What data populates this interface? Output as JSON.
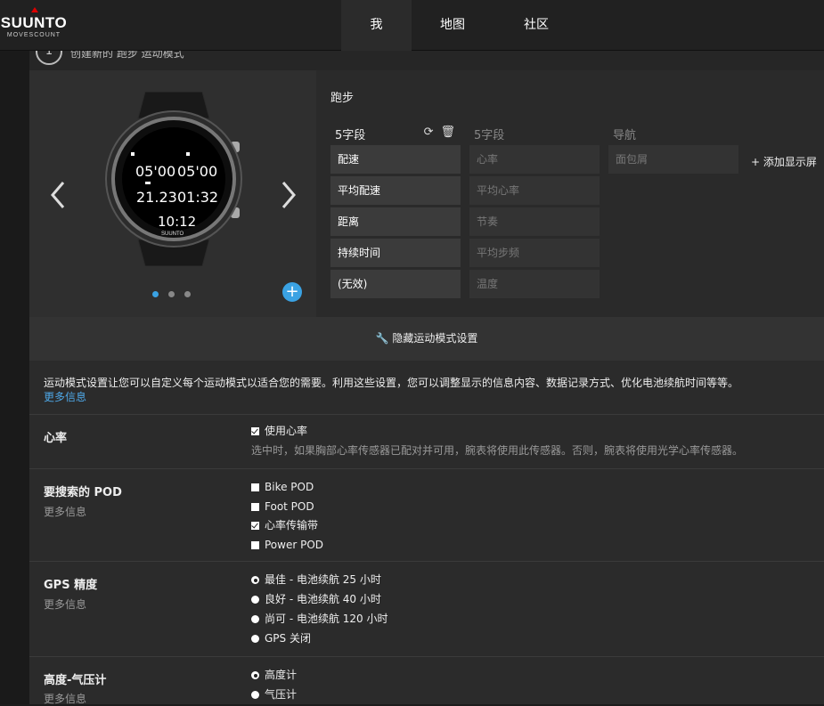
{
  "brand": {
    "name": "SUUNTO",
    "sub": "MOVESCOUNT"
  },
  "nav": [
    {
      "label": "我",
      "active": true
    },
    {
      "label": "地图"
    },
    {
      "label": "社区"
    }
  ],
  "create": {
    "step": "1",
    "text": "创建新的 跑步 运动模式"
  },
  "watch_face": {
    "top_left": "05'00",
    "top_right": "05'00",
    "mid_left": "21.23",
    "mid_right": "01:32",
    "bottom": "10:12",
    "brand": "SUUNTO"
  },
  "sport_mode": {
    "title": "跑步"
  },
  "columns": [
    {
      "title": "5字段",
      "cells": [
        "配速",
        "平均配速",
        "距离",
        "持续时间",
        "(无效)"
      ]
    },
    {
      "title": "5字段",
      "cells": [
        "心率",
        "平均心率",
        "节奏",
        "平均步频",
        "温度"
      ]
    },
    {
      "title": "导航",
      "cells": [
        "面包屑"
      ]
    }
  ],
  "add_screen": "+ 添加显示屏",
  "hide_settings": "隐藏运动模式设置",
  "intro": {
    "text": "运动模式设置让您可以自定义每个运动模式以适合您的需要。利用这些设置，您可以调整显示的信息内容、数据记录方式、优化电池续航时间等等。",
    "more": "更多信息"
  },
  "heart_rate": {
    "title": "心率",
    "option": "使用心率",
    "desc": "选中时，如果胸部心率传感器已配对并可用，腕表将使用此传感器。否则，腕表将使用光学心率传感器。"
  },
  "pod": {
    "title": "要搜索的 POD",
    "more": "更多信息",
    "options": [
      {
        "label": "Bike POD",
        "checked": false
      },
      {
        "label": "Foot POD",
        "checked": false
      },
      {
        "label": "心率传输带",
        "checked": true
      },
      {
        "label": "Power POD",
        "checked": false
      }
    ]
  },
  "gps": {
    "title": "GPS 精度",
    "more": "更多信息",
    "options": [
      {
        "label": "最佳 - 电池续航 25 小时",
        "checked": true
      },
      {
        "label": "良好 - 电池续航 40 小时"
      },
      {
        "label": "尚可 - 电池续航 120 小时"
      },
      {
        "label": "GPS 关闭"
      }
    ]
  },
  "altimeter": {
    "title": "高度-气压计",
    "more": "更多信息",
    "options": [
      {
        "label": "高度计",
        "checked": true
      },
      {
        "label": "气压计"
      }
    ]
  },
  "icons": {
    "prev": "chevron-left-icon",
    "next": "chevron-right-icon",
    "refresh": "refresh-icon",
    "delete": "trash-icon",
    "wrench": "wrench-icon",
    "add": "plus-icon"
  },
  "colors": {
    "accent": "#3aa2e3",
    "brand_mark": "#dd0000",
    "background": "#2b2b2b"
  }
}
